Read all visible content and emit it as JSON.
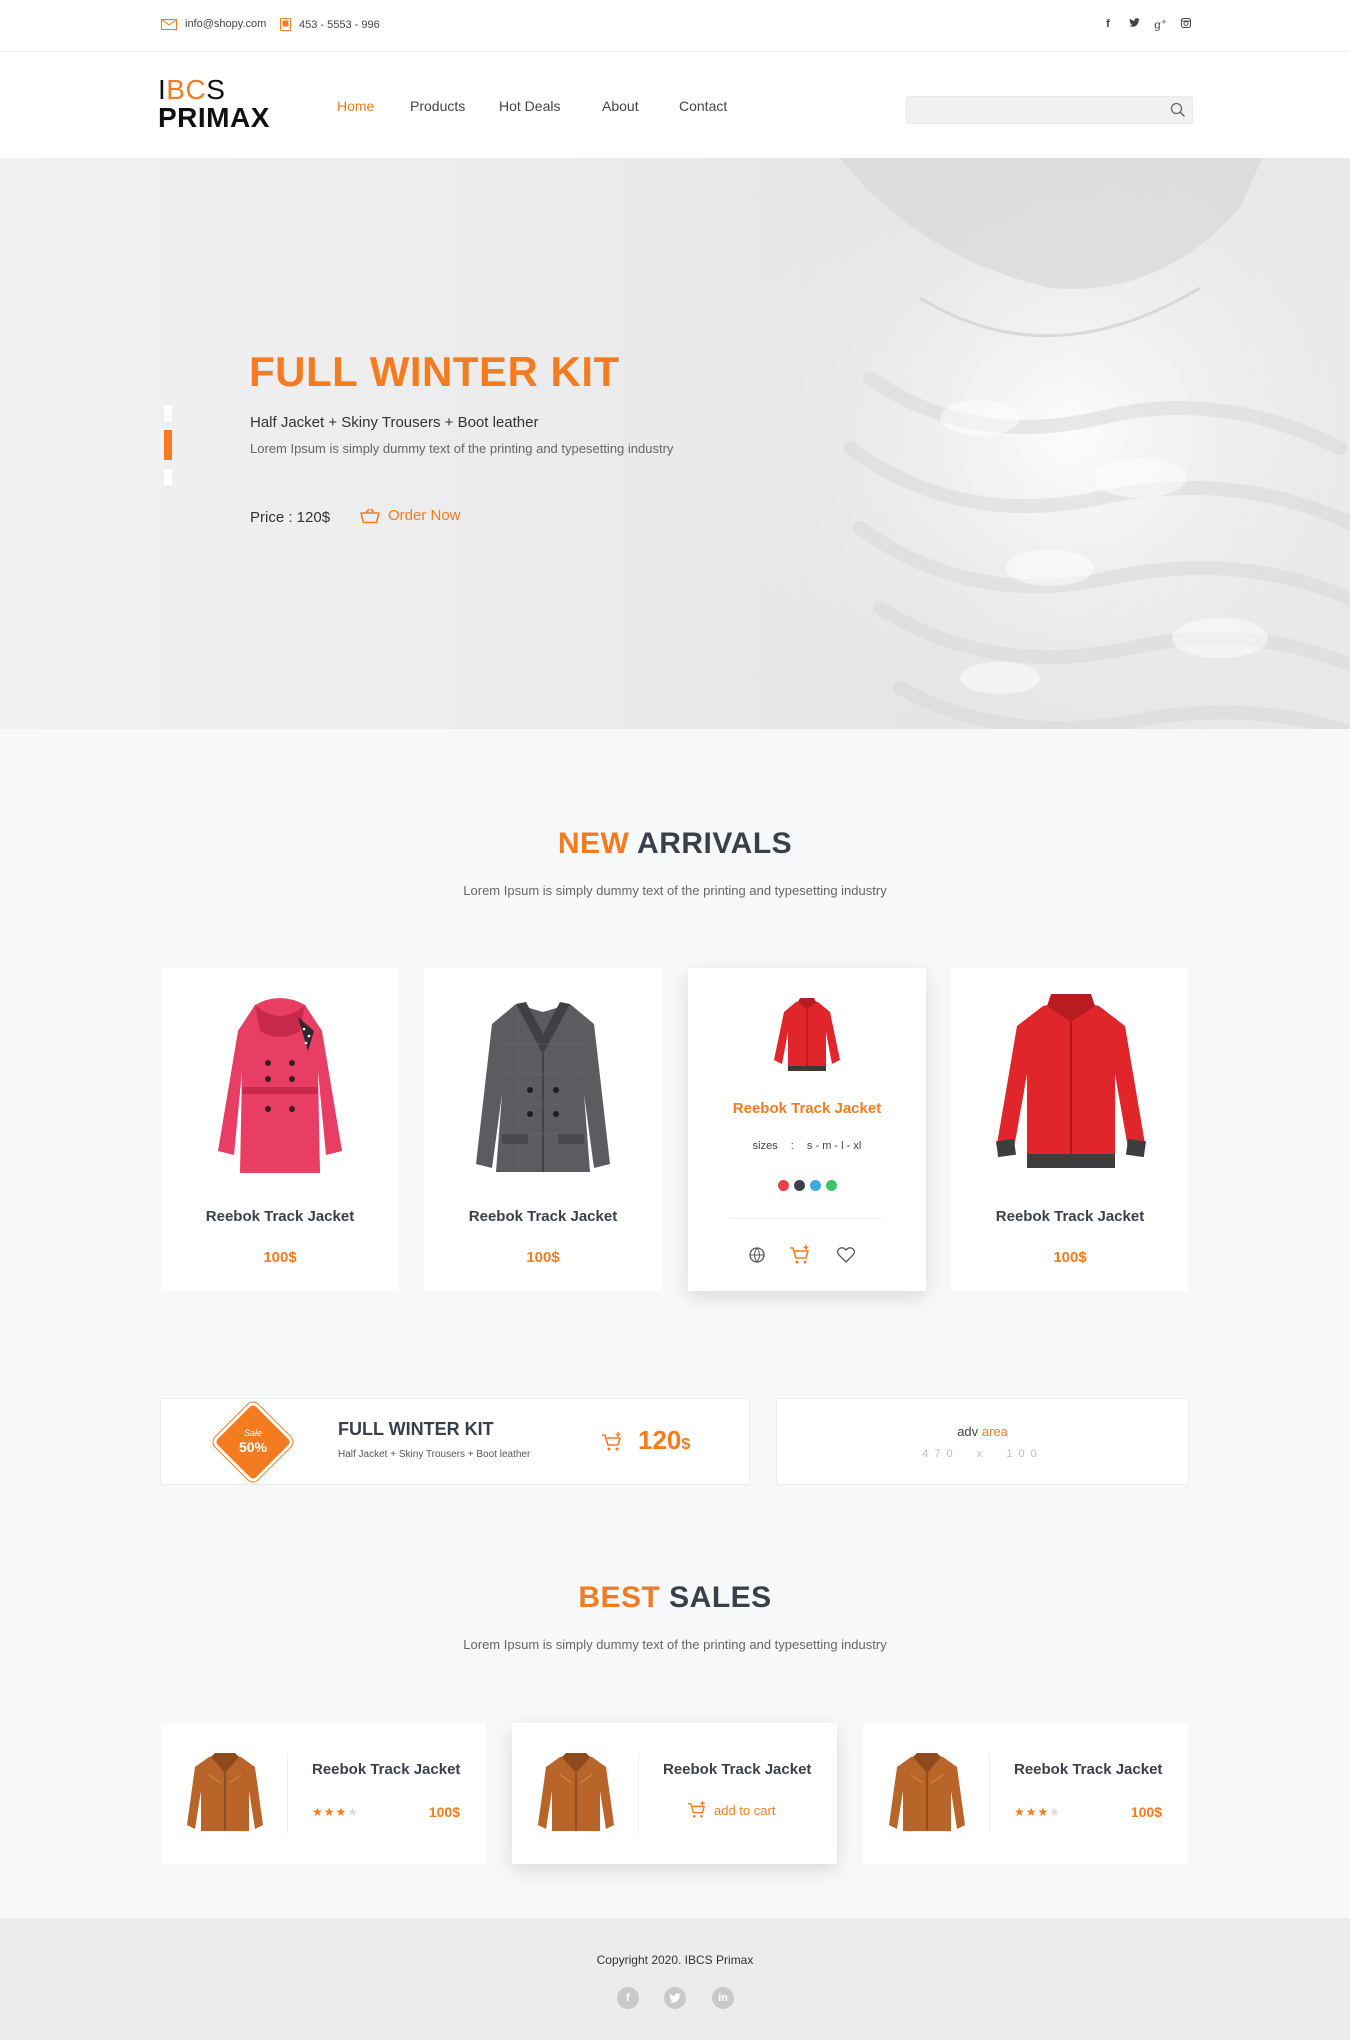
{
  "topbar": {
    "email": "info@shopy.com",
    "phone": "453 - 5553 - 996",
    "social": [
      "f",
      "t",
      "g+",
      "ig"
    ]
  },
  "header": {
    "logo_line1_pre": "I",
    "logo_line1_accent": "BC",
    "logo_line1_post": "S",
    "logo_line2": "PRIMAX",
    "nav": [
      "Home",
      "Products",
      "Hot Deals",
      "About",
      "Contact"
    ],
    "search_placeholder": ""
  },
  "hero": {
    "title": "FULL WINTER KIT",
    "subtitle": "Half Jacket + Skiny Trousers + Boot leather",
    "description": "Lorem Ipsum is simply dummy text of the printing and typesetting industry",
    "price": "Price : 120$",
    "order_label": "Order Now"
  },
  "new_arrivals": {
    "title_accent": "NEW",
    "title_rest": " ARRIVALS",
    "description": "Lorem Ipsum is simply dummy text of the printing and typesetting industry",
    "products": [
      {
        "name": "Reebok Track Jacket",
        "price": "100$"
      },
      {
        "name": "Reebok Track Jacket",
        "price": "100$"
      },
      {
        "name": "Reebok Track Jacket",
        "sizes_label": "sizes",
        "sizes_sep": ":",
        "sizes": "s - m - l - xl",
        "colors": [
          "#e8414b",
          "#3a4049",
          "#3fa8e0",
          "#3dc46a"
        ]
      },
      {
        "name": "Reebok Track Jacket",
        "price": "100$"
      }
    ]
  },
  "promo": {
    "badge_top": "Sale",
    "badge_bottom": "50%",
    "title": "FULL WINTER KIT",
    "subtitle": "Half Jacket + Skiny Trousers + Boot leather",
    "price": "120",
    "currency": "$",
    "adv_pre": "adv",
    "adv_accent": "area",
    "adv_size": "470  x  100"
  },
  "best_sales": {
    "title_accent": "BEST",
    "title_rest": " SALES",
    "description": "Lorem Ipsum is simply dummy text of the printing and typesetting industry",
    "items": [
      {
        "name": "Reebok Track Jacket",
        "stars": "★★★",
        "empty_stars": "★",
        "price": "100$"
      },
      {
        "name": "Reebok Track Jacket",
        "cart_label": "add to cart"
      },
      {
        "name": "Reebok Track Jacket",
        "stars": "★★★",
        "empty_stars": "★",
        "price": "100$"
      }
    ]
  },
  "footer": {
    "copyright": "Copyright 2020. IBCS Primax",
    "social": [
      "f",
      "t",
      "in"
    ]
  },
  "colors": {
    "accent": "#f47b20",
    "dark": "#3a4049"
  }
}
